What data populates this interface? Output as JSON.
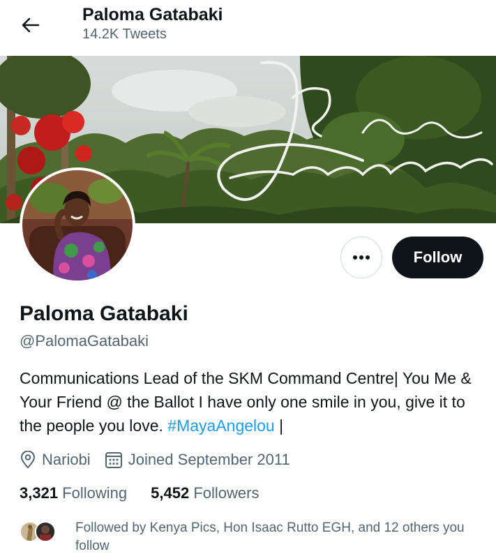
{
  "header": {
    "name": "Paloma Gatabaki",
    "tweet_count": "14.2K Tweets"
  },
  "banner": {
    "script_text": "The Gatabakis"
  },
  "profile": {
    "display_name": "Paloma Gatabaki",
    "handle": "@PalomaGatabaki",
    "bio_text": "Communications Lead of the SKM Command Centre| You Me & Your Friend @ the Ballot I have only one smile in you, give it to the people you love. ",
    "bio_hashtag": "#MayaAngelou",
    "bio_tail": " |",
    "location": "Nariobi",
    "joined": "Joined September 2011"
  },
  "actions": {
    "more_icon": "more-horizontal-icon",
    "follow_label": "Follow"
  },
  "stats": {
    "following_count": "3,321",
    "following_label": "Following",
    "followers_count": "5,452",
    "followers_label": "Followers"
  },
  "followed_by": {
    "text": "Followed by Kenya Pics, Hon Isaac Rutto EGH, and 12 others you follow"
  },
  "icons": {
    "back": "back-arrow-icon",
    "location": "location-pin-icon",
    "calendar": "calendar-icon"
  },
  "colors": {
    "primary_text": "#0f1419",
    "secondary_text": "#536471",
    "link": "#1d9bf0",
    "follow_button": "#0f1419",
    "border": "#cfd9de"
  }
}
